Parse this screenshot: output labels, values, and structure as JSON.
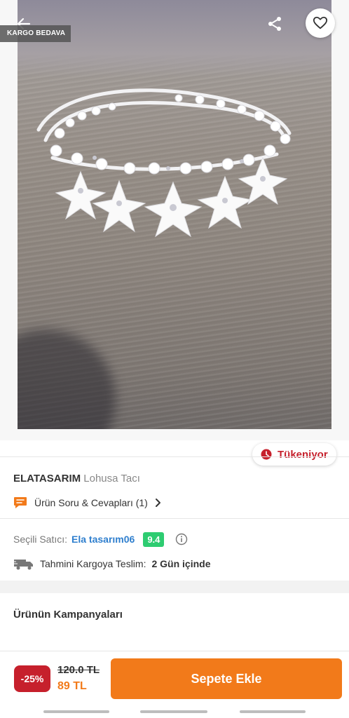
{
  "badges": {
    "cargo": "KARGO BEDAVA",
    "stock": "Tükeniyor"
  },
  "product": {
    "brand": "ELATASARIM",
    "name": "Lohusa Tacı",
    "qa_label": "Ürün Soru & Cevapları (1)"
  },
  "seller": {
    "label": "Seçili Satıcı:",
    "name": "Ela tasarım06",
    "score": "9.4"
  },
  "shipping": {
    "label": "Tahmini Kargoya Teslim:",
    "value": "2 Gün içinde"
  },
  "campaigns": {
    "title": "Ürünün Kampanyaları"
  },
  "price": {
    "discount": "-25%",
    "old": "120.0 TL",
    "current": "89 TL"
  },
  "actions": {
    "add_to_cart": "Sepete Ekle"
  },
  "icons": {
    "back": "arrow-left-icon",
    "share": "share-icon",
    "favorite": "heart-icon",
    "stock": "clock-icon",
    "qa": "chat-icon",
    "qa_chevron": "chevron-right-icon",
    "info": "info-icon",
    "truck": "truck-icon"
  },
  "colors": {
    "brand_orange": "#f27a1a",
    "alert_red": "#c6202c",
    "seller_blue": "#2f7fce",
    "score_green": "#2ecc71"
  }
}
